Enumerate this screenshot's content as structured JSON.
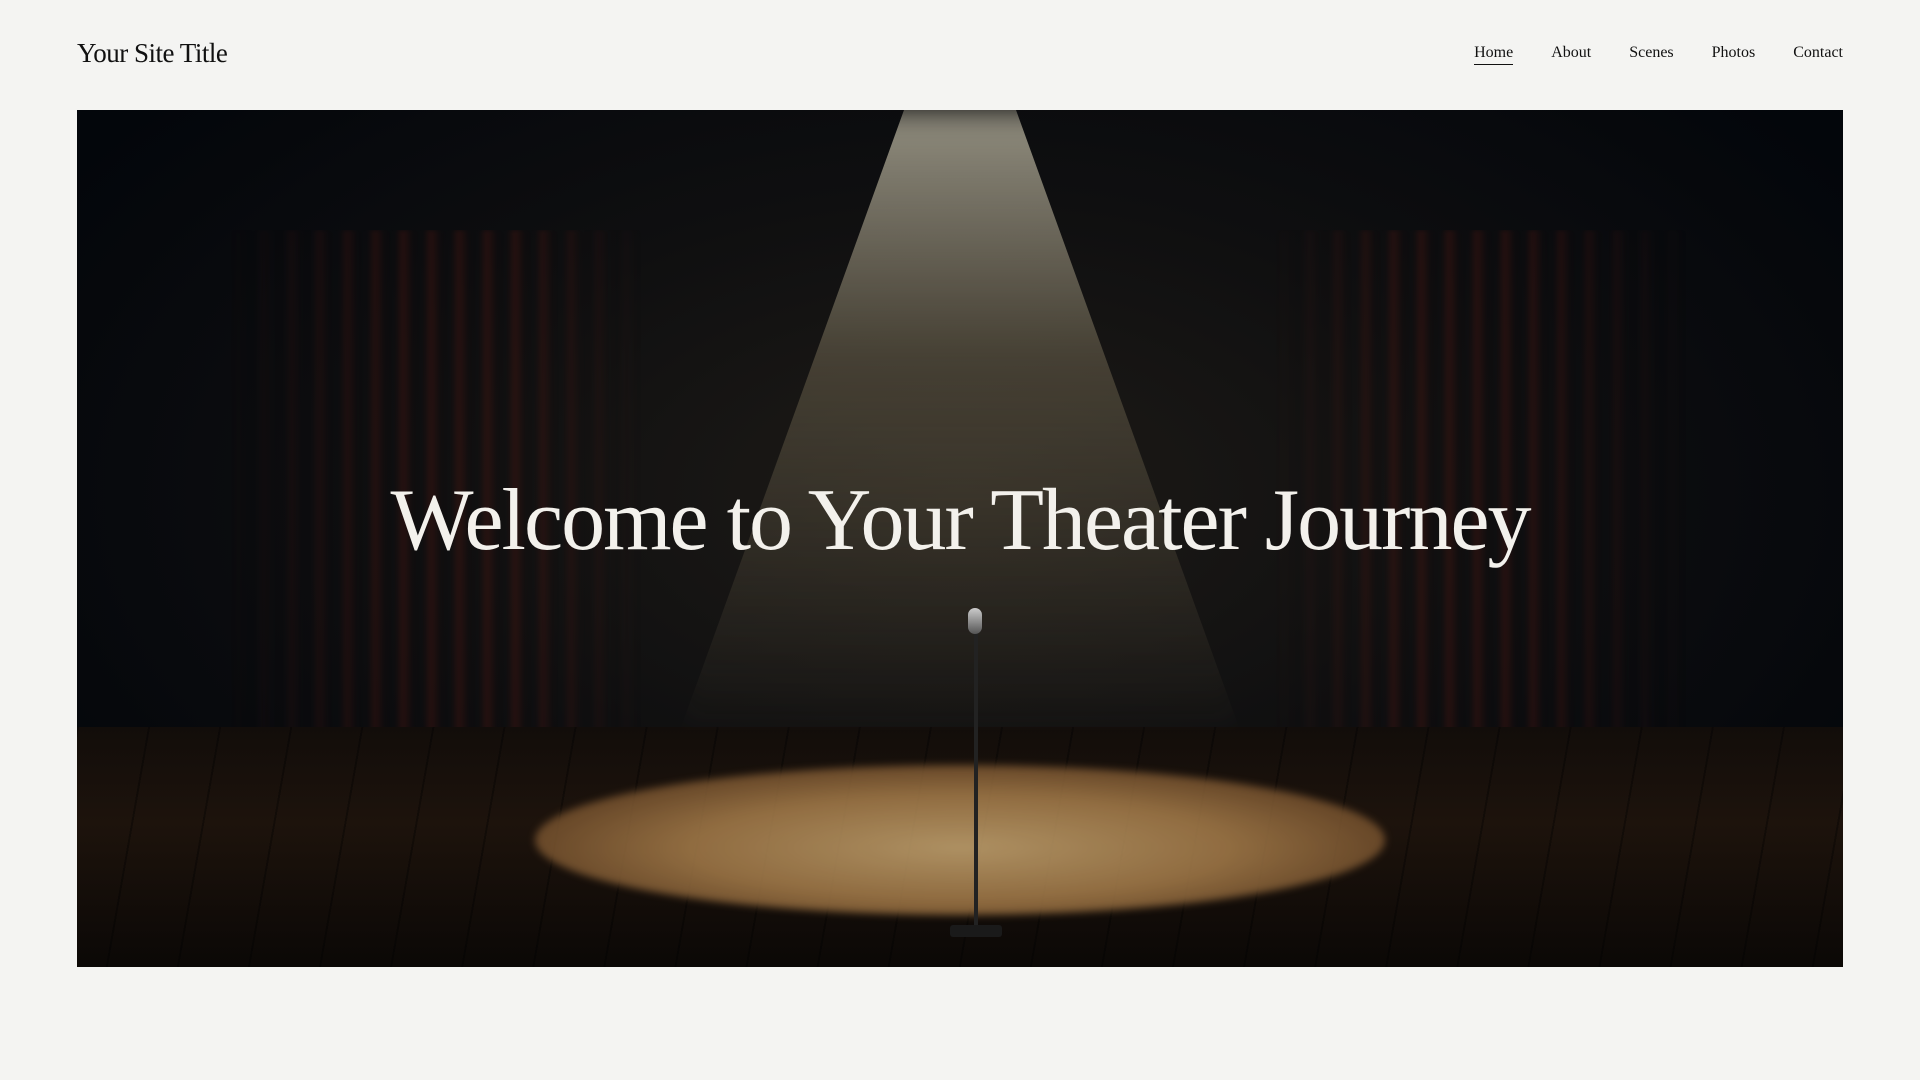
{
  "header": {
    "site_title": "Your Site Title",
    "nav": [
      {
        "label": "Home",
        "active": true
      },
      {
        "label": "About"
      },
      {
        "label": "Scenes"
      },
      {
        "label": "Photos"
      },
      {
        "label": "Contact"
      }
    ]
  },
  "hero": {
    "heading": "Welcome to Your Theater Journey"
  }
}
